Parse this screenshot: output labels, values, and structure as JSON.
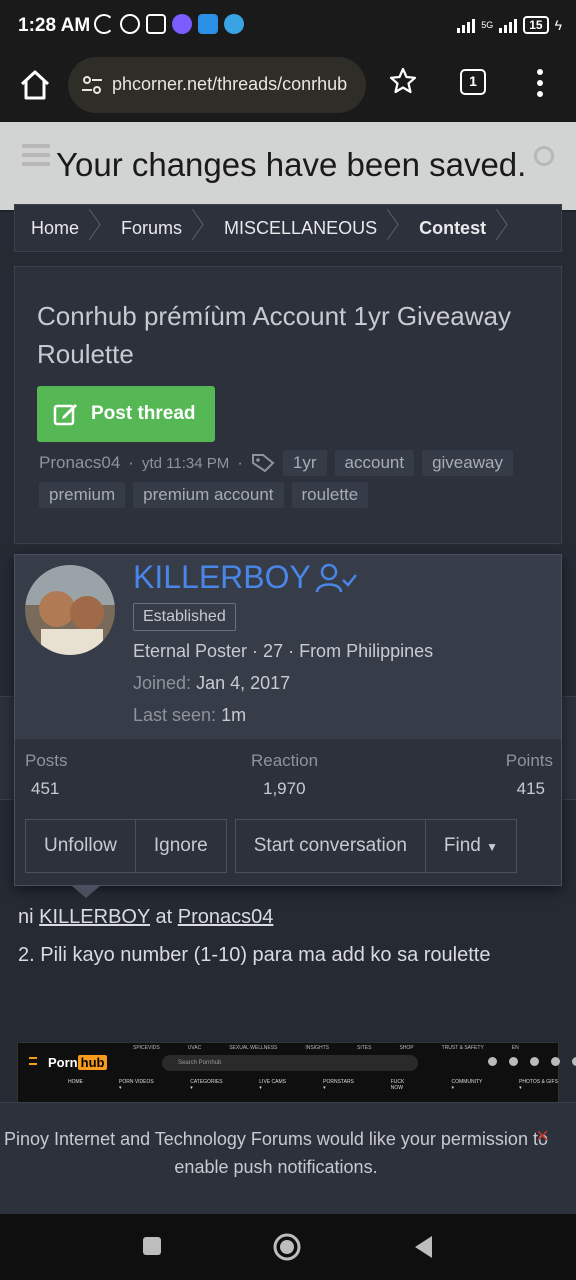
{
  "status": {
    "time": "1:28 AM",
    "network": "5G",
    "battery": "15"
  },
  "browser": {
    "url": "phcorner.net/threads/conrhub",
    "tab_count": "1",
    "icons": [
      "home-icon",
      "tune-icon",
      "star-icon",
      "tabs-icon",
      "menu-icon"
    ]
  },
  "toast": {
    "message": "Your changes have been saved."
  },
  "breadcrumb": [
    "Home",
    "Forums",
    "MISCELLANEOUS",
    "Contest"
  ],
  "thread": {
    "title": "Conrhub prémíùm Account 1yr Giveaway Roulette",
    "post_button": "Post thread",
    "author": "Pronacs04",
    "time": "ytd 11:34 PM",
    "tags": [
      "1yr",
      "account",
      "giveaway",
      "premium",
      "premium account",
      "roulette"
    ]
  },
  "user_card": {
    "username": "KILLERBOY",
    "badge": "Established",
    "title_line": "Eternal Poster · 27 · From Philippines",
    "joined_label": "Joined:",
    "joined_value": "Jan 4, 2017",
    "last_seen_label": "Last seen:",
    "last_seen_value": "1m",
    "stats": {
      "posts_label": "Posts",
      "posts_value": "451",
      "reaction_label": "Reaction",
      "reaction_value": "1,970",
      "points_label": "Points",
      "points_value": "415"
    },
    "actions": {
      "unfollow": "Unfollow",
      "ignore": "Ignore",
      "start_conversation": "Start conversation",
      "find": "Find"
    }
  },
  "post": {
    "line1_prefix": "ni",
    "line1_user1": "KILLERBOY",
    "line1_mid": "at",
    "line1_user2": "Pronacs04",
    "line2": "2. Pili kayo number (1-10) para ma add ko sa roulette"
  },
  "embed": {
    "logo_a": "Porn",
    "logo_b": "hub",
    "search_placeholder": "Search Pornhub",
    "top_links": [
      "SPICEVIDS",
      "UVAC",
      "SEXUAL WELLNESS",
      "INSIGHTS",
      "SITES",
      "SHOP",
      "TRUST & SAFETY",
      "EN"
    ],
    "nav": [
      "HOME",
      "PORN VIDEOS ▾",
      "CATEGORIES ▾",
      "LIVE CAMS ▾",
      "PORNSTARS ▾",
      "FUCK NOW",
      "COMMUNITY ▾",
      "PHOTOS & GIFS ▾"
    ]
  },
  "notification": {
    "text": "Pinoy Internet and Technology Forums would like your permission to enable push notifications.",
    "close": "×"
  },
  "colors": {
    "accent_blue": "#4a86e8",
    "post_button_green": "#56b855",
    "background": "#262a33",
    "card": "#2c313b"
  }
}
